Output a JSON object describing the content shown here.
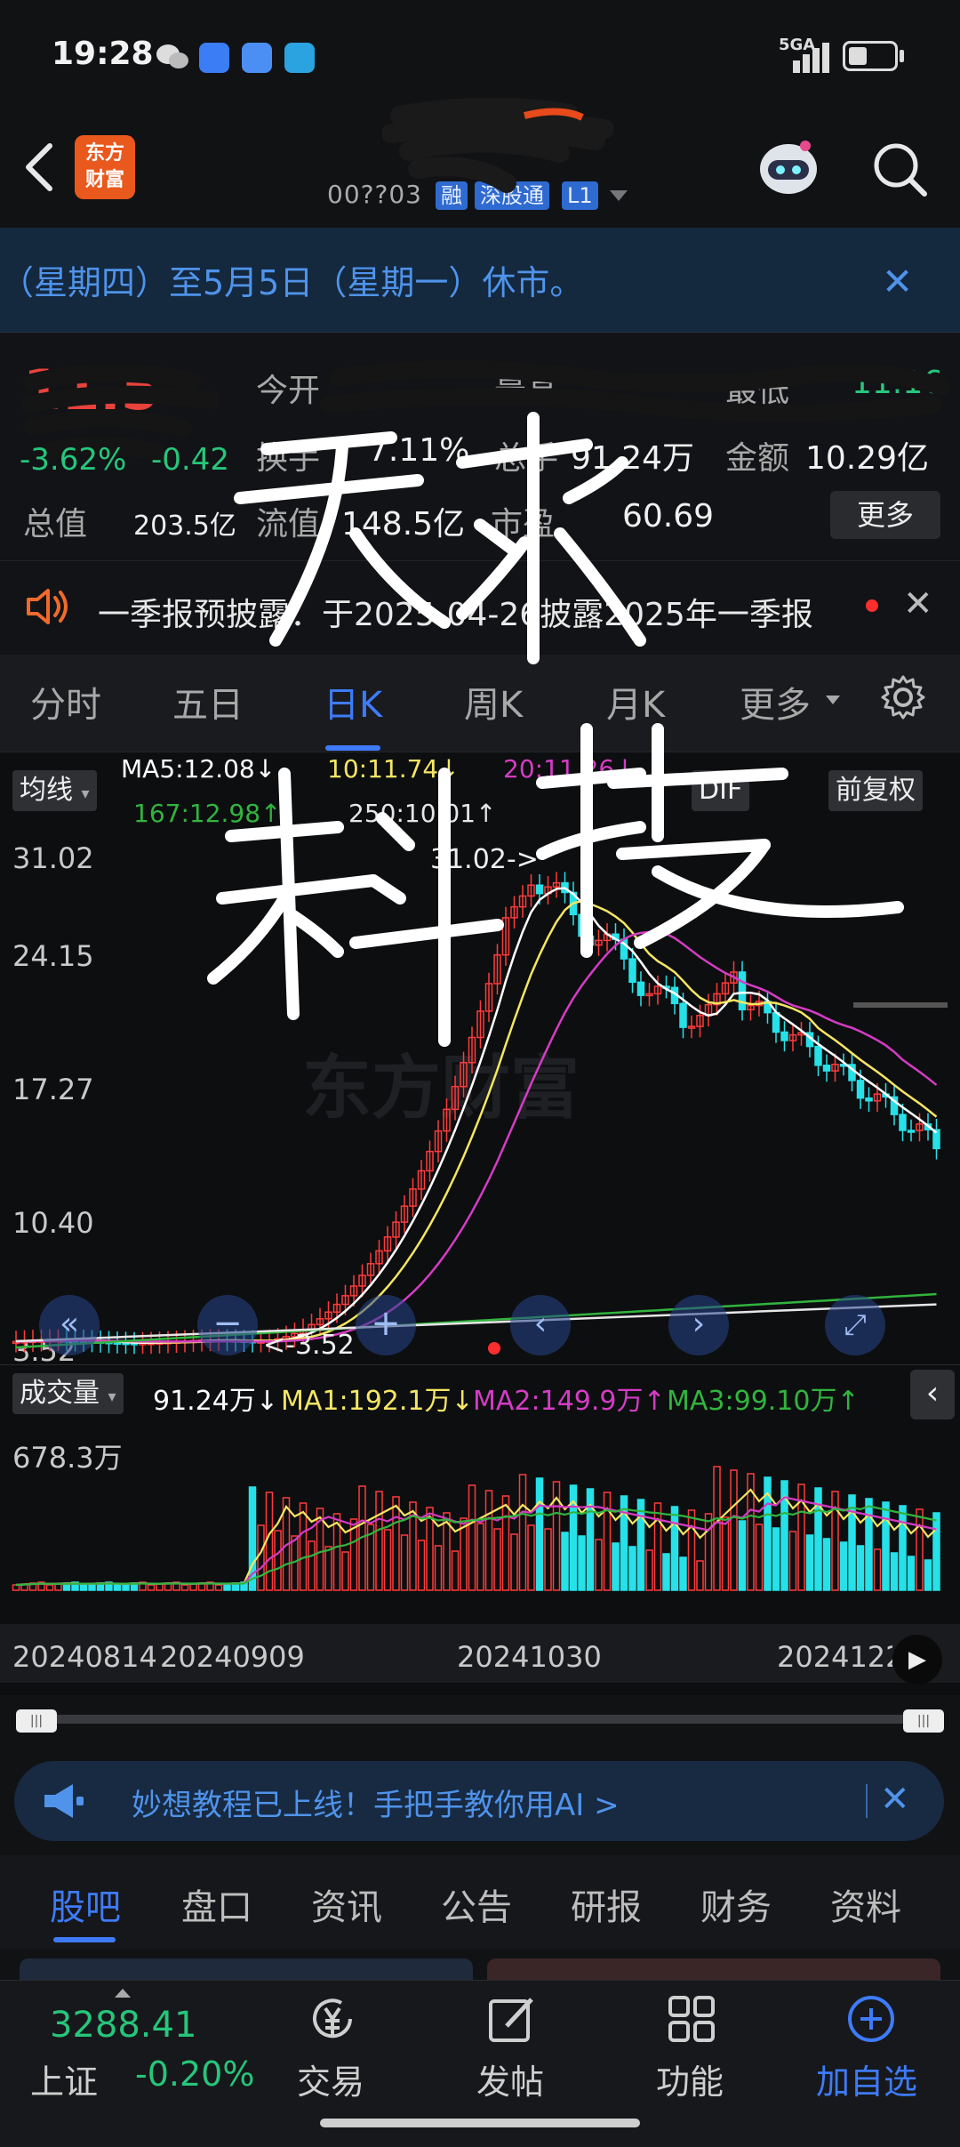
{
  "status_bar": {
    "time": "19:28",
    "network": "5GA",
    "icons": [
      "wechat-icon",
      "app-blue-icon",
      "cloud-icon",
      "telegram-icon"
    ]
  },
  "header": {
    "back_icon": "chevron-left-icon",
    "logo_text_line1": "东方",
    "logo_text_line2": "财富",
    "stock_code_visible": "00??03",
    "badge_rong": "融",
    "badge_market": "深股通",
    "badge_level": "L1",
    "robot_icon": "robot-assistant-icon",
    "search_icon": "search-icon"
  },
  "notice": {
    "text": "（星期四）至5月5日（星期一）休市。"
  },
  "quote": {
    "change_pct": "-3.62%",
    "change_abs": "-0.42",
    "open_label": "今开",
    "high_label": "最高",
    "low_label": "最低",
    "low_value": "11.16",
    "turnover_label": "换手",
    "turnover_value": "7.11%",
    "volume_label": "总手",
    "volume_value": "91.24万",
    "amount_label": "金额",
    "amount_value": "10.29亿",
    "mktcap_label": "总值",
    "mktcap_value": "203.5亿",
    "float_label": "流值",
    "float_value": "148.5亿",
    "pe_label": "市盈",
    "pe_value": "60.69",
    "more_label": "更多"
  },
  "info_bar": {
    "text": "一季报预披露：于2025-04-26披露2025年一季报"
  },
  "period_tabs": [
    {
      "label": "分时",
      "active": false
    },
    {
      "label": "五日",
      "active": false
    },
    {
      "label": "日K",
      "active": true
    },
    {
      "label": "周K",
      "active": false
    },
    {
      "label": "月K",
      "active": false
    },
    {
      "label": "更多",
      "active": false
    }
  ],
  "ma_legend": {
    "selector": "均线",
    "ma5": "MA5:12.08↓",
    "ma10": "10:11.74↓",
    "ma20": "20:11.26↓",
    "ma167": "167:12.98↑",
    "ma250": "250:10.01↑",
    "indicator": "DIF",
    "adjust": "前复权",
    "colors": {
      "ma5": "#ffffff",
      "ma10": "#f5e663",
      "ma20": "#d43cc4",
      "ma167": "#31b43e",
      "ma250": "#e6e6e6"
    }
  },
  "price_axis": [
    "31.02",
    "24.15",
    "17.27",
    "10.40",
    "3.52"
  ],
  "annotations": {
    "peak": "31.02->",
    "trough": "<-3.52"
  },
  "volume": {
    "selector": "成交量",
    "current": "91.24万↓",
    "ma1": "MA1:192.1万↓",
    "ma2": "MA2:149.9万↑",
    "ma3": "MA3:99.10万↑",
    "axis_top": "678.3万"
  },
  "dates": [
    "20240814",
    "20240909",
    "20241030",
    "20241227"
  ],
  "watermark": "东方财富",
  "handwritten_text": [
    "天求",
    "科技"
  ],
  "promo": {
    "text": "妙想教程已上线！手把手教你用AI >"
  },
  "section_tabs": [
    {
      "label": "股吧",
      "active": true
    },
    {
      "label": "盘口",
      "active": false
    },
    {
      "label": "资讯",
      "active": false
    },
    {
      "label": "公告",
      "active": false
    },
    {
      "label": "研报",
      "active": false
    },
    {
      "label": "财务",
      "active": false
    },
    {
      "label": "资料",
      "active": false
    }
  ],
  "bottom_nav": {
    "index_value": "3288.41",
    "index_name": "上证",
    "index_change": "-0.20%",
    "items": [
      {
        "label": "交易",
        "icon": "trade-yen-icon"
      },
      {
        "label": "发帖",
        "icon": "compose-icon"
      },
      {
        "label": "功能",
        "icon": "grid-icon"
      },
      {
        "label": "加自选",
        "icon": "add-circle-icon"
      }
    ]
  }
}
